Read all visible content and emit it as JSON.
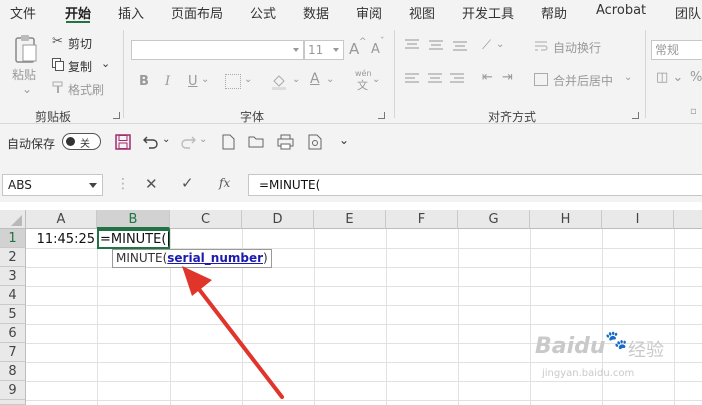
{
  "menu": {
    "tabs": [
      "文件",
      "开始",
      "插入",
      "页面布局",
      "公式",
      "数据",
      "审阅",
      "视图",
      "开发工具",
      "帮助",
      "Acrobat",
      "团队"
    ],
    "active": "开始"
  },
  "ribbon": {
    "clipboard": {
      "paste": "粘贴",
      "cut": "剪切",
      "copy": "复制",
      "format_painter": "格式刷",
      "group": "剪贴板"
    },
    "font": {
      "size": "11",
      "bold": "B",
      "italic": "I",
      "underline": "U",
      "grow": "A",
      "shrink": "A",
      "font_color": "A",
      "wen": "wén",
      "group": "字体"
    },
    "alignment": {
      "wrap": "自动换行",
      "merge": "合并后居中",
      "group": "对齐方式"
    },
    "number": {
      "format": "常规"
    }
  },
  "qat": {
    "autosave_label": "自动保存",
    "autosave_state": "关"
  },
  "formula_bar": {
    "name_box": "ABS",
    "cancel": "✕",
    "enter": "✓",
    "fx": "fx",
    "formula": "=MINUTE("
  },
  "grid": {
    "columns": [
      "A",
      "B",
      "C",
      "D",
      "E",
      "F",
      "G",
      "H",
      "I"
    ],
    "rows": [
      "1",
      "2",
      "3",
      "4",
      "5",
      "6",
      "7",
      "8",
      "9"
    ],
    "a1": "11:45:25",
    "b1": "=MINUTE("
  },
  "tooltip": {
    "func": "MINUTE(",
    "arg": "serial_number",
    "close": ")"
  },
  "watermark": {
    "brand": "Baidu",
    "sub": "经验",
    "url": "jingyan.baidu.com"
  },
  "colors": {
    "accent": "#217346",
    "arrow": "#e0352b",
    "tooltip_arg": "#1b1bb0"
  }
}
